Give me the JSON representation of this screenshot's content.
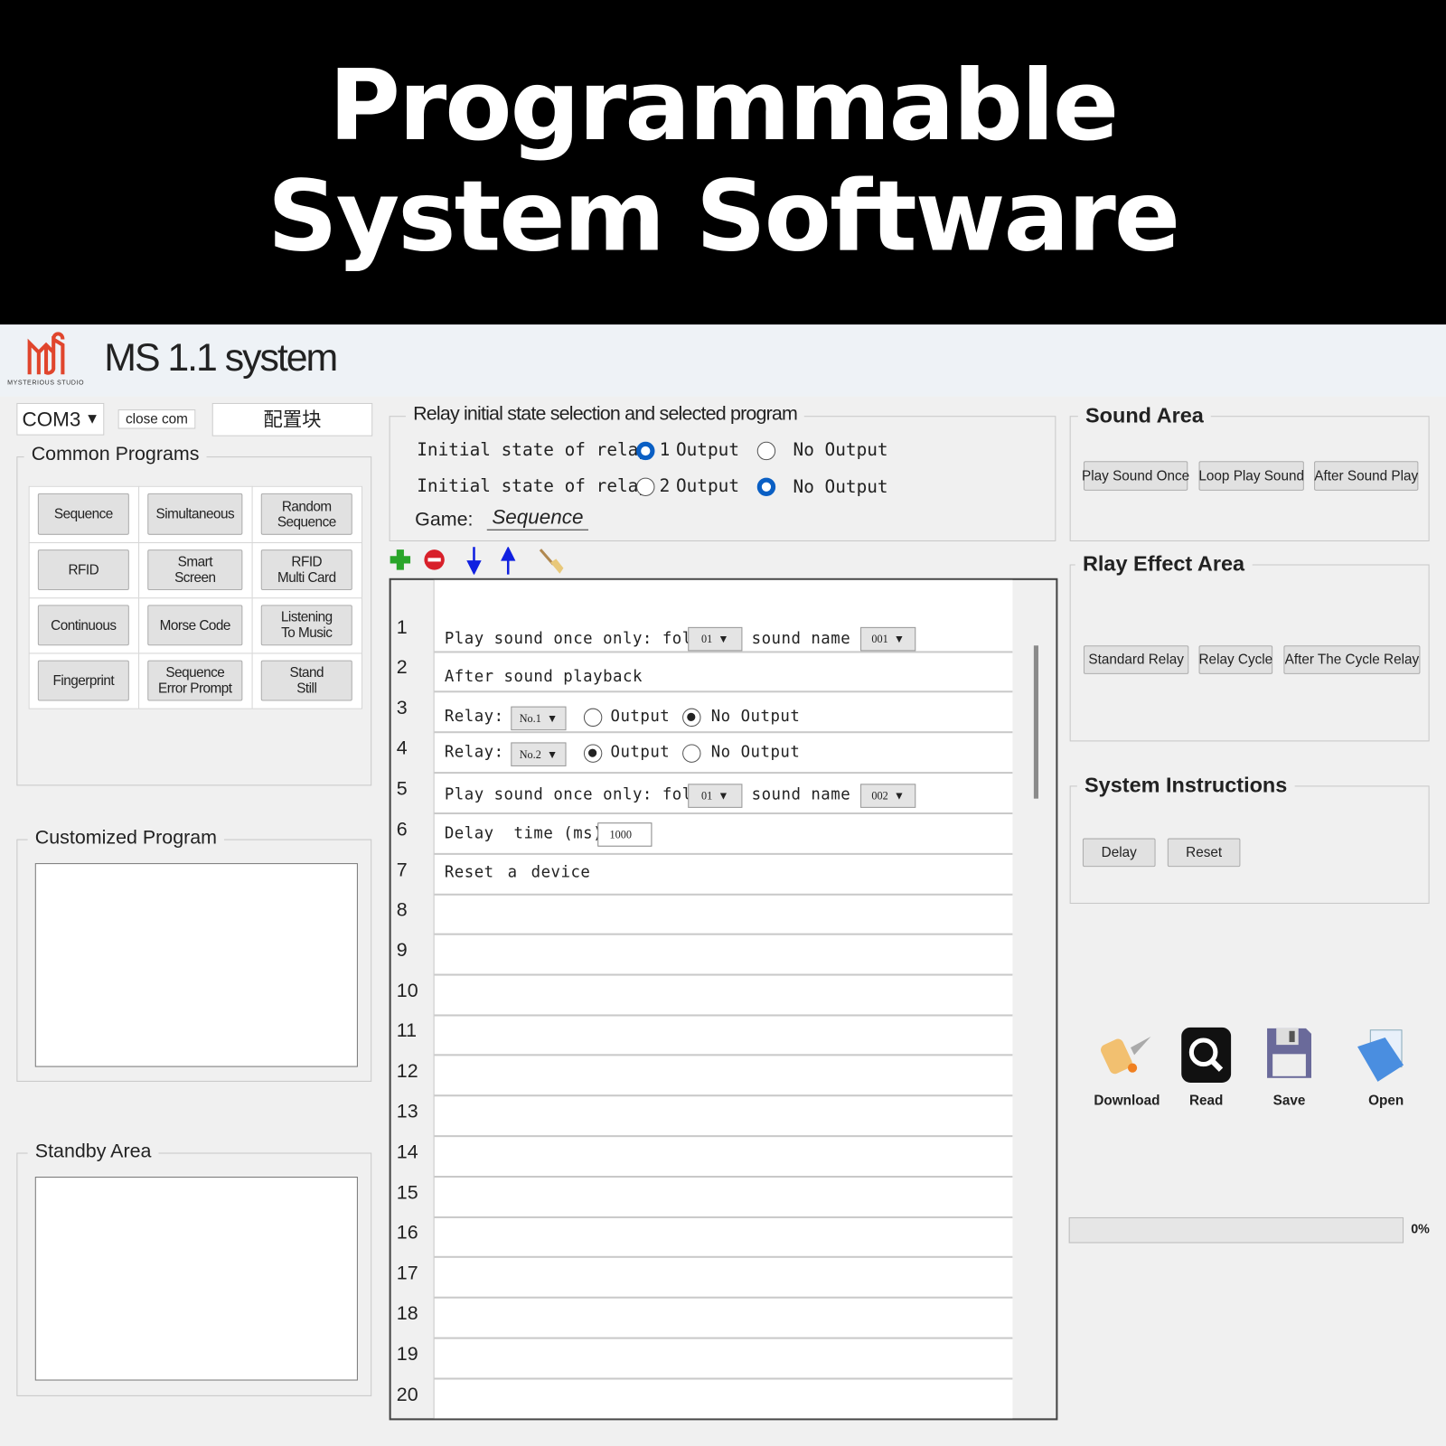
{
  "banner": {
    "line1": "Programmable",
    "line2": "System Software"
  },
  "app": {
    "title": "MS 1.1 system",
    "logo_text": "MYSTERIOUS STUDIO"
  },
  "toolbar": {
    "port": "COM3",
    "close_com": "close com",
    "config_block": "配置块"
  },
  "common_programs": {
    "title": "Common Programs",
    "items": [
      "Sequence",
      "Simultaneous",
      "Random Sequence",
      "RFID",
      "Smart Screen",
      "RFID Multi Card",
      "Continuous",
      "Morse Code",
      "Listening To Music",
      "Fingerprint",
      "Sequence Error Prompt",
      "Stand Still"
    ]
  },
  "customized": {
    "title": "Customized Program"
  },
  "standby": {
    "title": "Standby Area"
  },
  "relay_state": {
    "title": "Relay initial state selection and selected program",
    "relay1_label": "Initial state of relay 1",
    "relay2_label": "Initial state of relay 2",
    "output": "Output",
    "no_output": "No Output",
    "relay1": "Output",
    "relay2": "No Output",
    "game_label": "Game:",
    "game_value": "Sequence"
  },
  "list_tools": [
    "add-icon",
    "remove-icon",
    "move-down-icon",
    "move-up-icon",
    "clear-broom-icon"
  ],
  "program_rows": {
    "numbers": [
      "1",
      "2",
      "3",
      "4",
      "5",
      "6",
      "7",
      "8",
      "9",
      "10",
      "11",
      "12",
      "13",
      "14",
      "15",
      "16",
      "17",
      "18",
      "19",
      "20"
    ],
    "r1": {
      "text": "Play sound once only: folder",
      "folder": "01",
      "sound_label": "sound name",
      "sound": "001"
    },
    "r2": {
      "text": "After sound playback"
    },
    "r3": {
      "label": "Relay:",
      "relay": "No.1",
      "output": "Output",
      "no_output": "No Output",
      "selected": "No Output"
    },
    "r4": {
      "label": "Relay:",
      "relay": "No.2",
      "output": "Output",
      "no_output": "No Output",
      "selected": "Output"
    },
    "r5": {
      "text": "Play sound once only: folder",
      "folder": "01",
      "sound_label": "sound name",
      "sound": "002"
    },
    "r6": {
      "text": "Delay  time (ms)",
      "value": "1000"
    },
    "r7": {
      "text": "Reset a device"
    }
  },
  "sound_area": {
    "title": "Sound Area",
    "buttons": [
      "Play Sound Once",
      "Loop Play Sound",
      "After Sound Play"
    ]
  },
  "relay_effect": {
    "title": "Rlay Effect Area",
    "buttons": [
      "Standard Relay",
      "Relay Cycle",
      "After The Cycle Relay"
    ]
  },
  "system_instructions": {
    "title": "System Instructions",
    "buttons": [
      "Delay",
      "Reset"
    ]
  },
  "actions": [
    "Download",
    "Read",
    "Save",
    "Open"
  ],
  "progress": {
    "value": 0,
    "label": "0%"
  },
  "colors": {
    "accent": "#0a5fc4",
    "logo": "#e0452c"
  }
}
